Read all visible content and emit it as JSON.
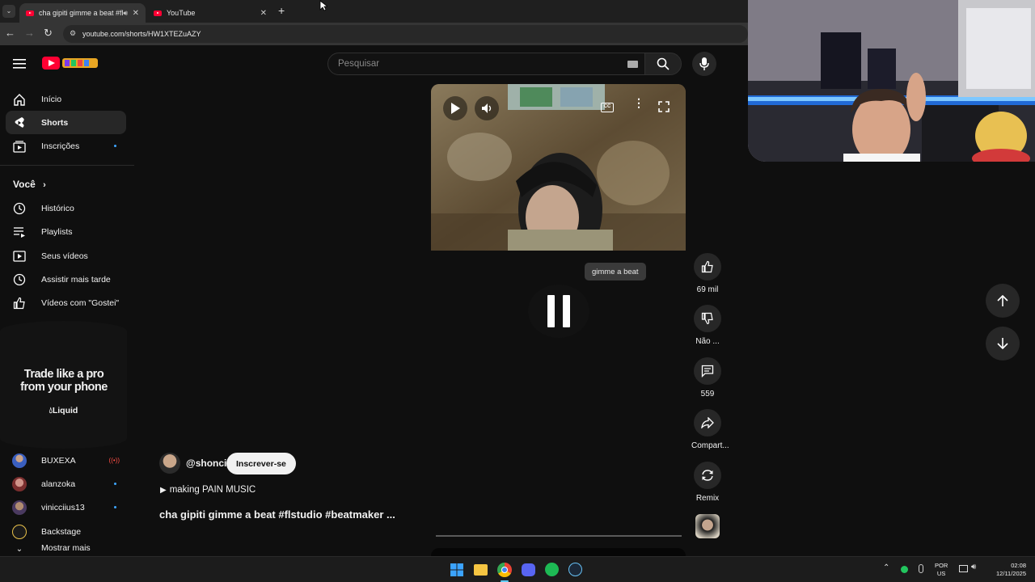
{
  "browser": {
    "tabs": [
      {
        "title": "cha gipiti gimme a beat #fl",
        "active": true
      },
      {
        "title": "YouTube",
        "active": false
      }
    ],
    "url": "youtube.com/shorts/HW1XTEZuAZY"
  },
  "header": {
    "search_placeholder": "Pesquisar"
  },
  "sidebar": {
    "main": [
      {
        "label": "Início",
        "icon": "home-icon"
      },
      {
        "label": "Shorts",
        "icon": "shorts-icon",
        "active": true
      },
      {
        "label": "Inscrições",
        "icon": "subscriptions-icon"
      }
    ],
    "you_heading": "Você",
    "you": [
      {
        "label": "Histórico",
        "icon": "history-icon"
      },
      {
        "label": "Playlists",
        "icon": "playlists-icon"
      },
      {
        "label": "Seus vídeos",
        "icon": "your-videos-icon"
      },
      {
        "label": "Assistir mais tarde",
        "icon": "watch-later-icon"
      },
      {
        "label": "Vídeos com \"Gostei\"",
        "icon": "liked-icon"
      }
    ],
    "ad": {
      "headline": "Trade like a pro from your phone",
      "brand": "Liquid"
    },
    "subscriptions": [
      {
        "label": "BUXEXA",
        "live": true
      },
      {
        "label": "alanzoka"
      },
      {
        "label": "vinicciius13"
      },
      {
        "label": "Backstage"
      }
    ],
    "show_more": "Mostrar mais"
  },
  "short": {
    "channel": "@shonci",
    "subscribe_label": "Inscrever-se",
    "music": "making PAIN MUSIC",
    "title": "cha gipiti gimme a beat #flstudio #beatmaker ...",
    "tooltip": "gimme a beat"
  },
  "actions": {
    "likes": "69 mil",
    "dislike": "Não ...",
    "comments": "559",
    "share": "Compart...",
    "remix": "Remix"
  },
  "tray": {
    "lang": "POR",
    "layout": "US",
    "time": "02:08",
    "date": "12/11/2025"
  },
  "colors": {
    "background": "#0f0f0f",
    "accent": "#ff0033",
    "live": "#ff4e45",
    "dot": "#3ea6ff"
  }
}
